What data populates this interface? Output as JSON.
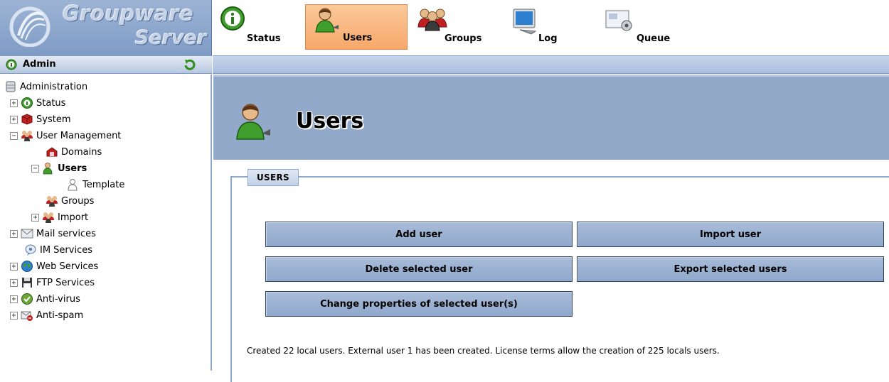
{
  "logo": {
    "line1": "Groupware",
    "line2": "Server"
  },
  "toolbar": {
    "items": [
      {
        "label": "Status",
        "icon": "info-icon"
      },
      {
        "label": "Users",
        "icon": "user-icon",
        "active": true
      },
      {
        "label": "Groups",
        "icon": "groups-icon"
      },
      {
        "label": "Log",
        "icon": "monitor-icon"
      },
      {
        "label": "Queue",
        "icon": "queue-icon"
      }
    ]
  },
  "admin_bar": {
    "label": "Admin",
    "left_icon": "info-icon",
    "right_icon": "refresh-icon"
  },
  "sidebar": {
    "items": [
      {
        "label": "Administration",
        "icon": "database-icon"
      },
      {
        "label": "Status",
        "icon": "info-icon",
        "expander": "+"
      },
      {
        "label": "System",
        "icon": "cube-icon",
        "expander": "+"
      },
      {
        "label": "User Management",
        "icon": "groups-icon",
        "expander": "−"
      },
      {
        "label": "Domains",
        "icon": "domain-icon"
      },
      {
        "label": "Users",
        "icon": "user-icon",
        "expander": "−",
        "selected": true
      },
      {
        "label": "Template",
        "icon": "user-outline-icon"
      },
      {
        "label": "Groups",
        "icon": "groups-icon"
      },
      {
        "label": "Import",
        "icon": "groups-icon",
        "expander": "+"
      },
      {
        "label": "Mail services",
        "icon": "mail-icon",
        "expander": "+"
      },
      {
        "label": "IM Services",
        "icon": "chat-icon"
      },
      {
        "label": "Web Services",
        "icon": "globe-icon",
        "expander": "+"
      },
      {
        "label": "FTP Services",
        "icon": "floppy-icon",
        "expander": "+"
      },
      {
        "label": "Anti-virus",
        "icon": "antivirus-icon",
        "expander": "+"
      },
      {
        "label": "Anti-spam",
        "icon": "antispam-icon",
        "expander": "+"
      }
    ]
  },
  "main": {
    "title": "Users",
    "section_label": "USERS",
    "buttons": {
      "add_user": "Add user",
      "import_user": "Import user",
      "delete_selected": "Delete selected user",
      "export_selected": "Export selected users",
      "change_properties": "Change properties of selected user(s)"
    },
    "note": "Created 22 local users. External user 1 has been created. License terms allow the creation of 225 locals users."
  },
  "colors": {
    "header_blue": "#93a9ca",
    "button_blue": "#8fa8cc",
    "active_tab_orange": "#f7a86a"
  }
}
